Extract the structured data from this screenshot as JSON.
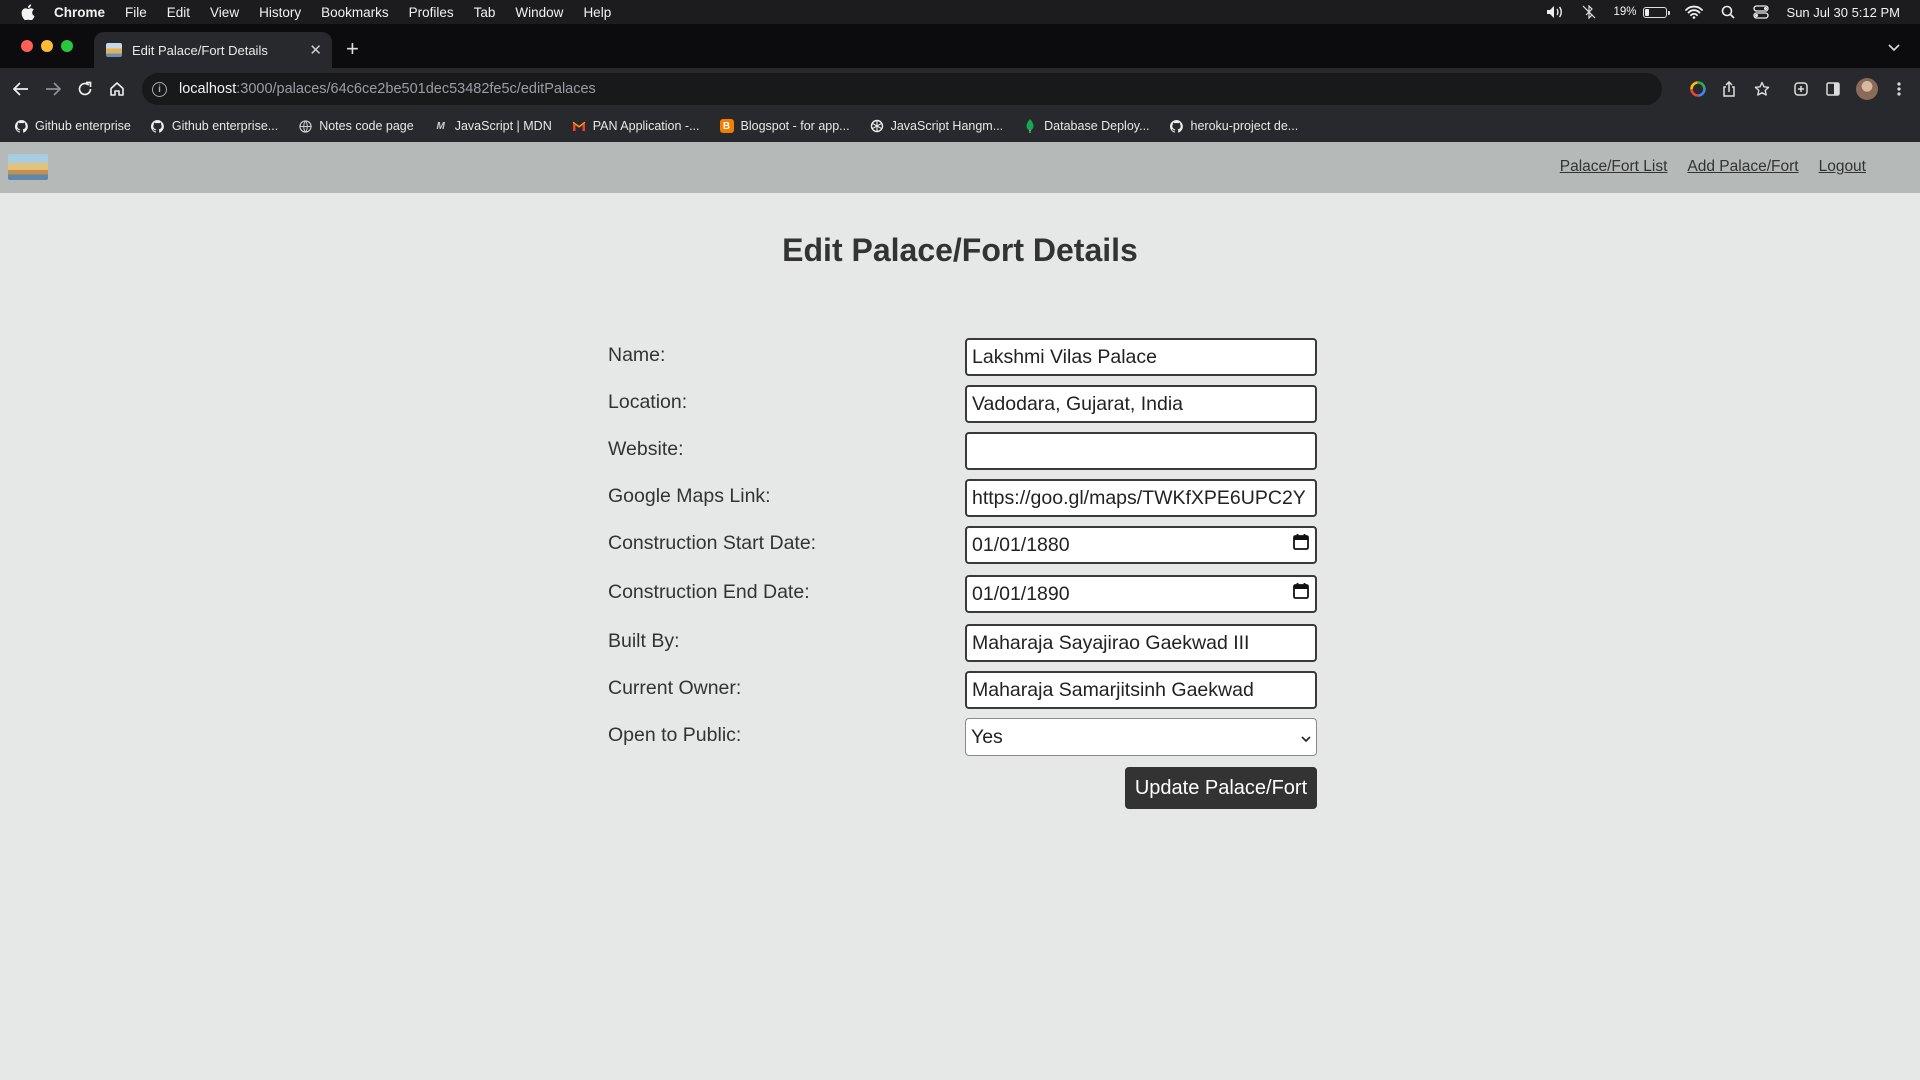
{
  "menubar": {
    "app_name": "Chrome",
    "items": [
      "File",
      "Edit",
      "View",
      "History",
      "Bookmarks",
      "Profiles",
      "Tab",
      "Window",
      "Help"
    ],
    "battery_percent": "19%",
    "datetime": "Sun Jul 30  5:12 PM"
  },
  "browser": {
    "tab_title": "Edit Palace/Fort Details",
    "url_host": "localhost",
    "url_path": ":3000/palaces/64c6ce2be501dec53482fe5c/editPalaces",
    "bookmarks": [
      {
        "label": "Github enterprise",
        "icon": "github-icon"
      },
      {
        "label": "Github enterprise...",
        "icon": "github-icon"
      },
      {
        "label": "Notes code page",
        "icon": "globe-icon"
      },
      {
        "label": "JavaScript | MDN",
        "icon": "mdn-icon"
      },
      {
        "label": "PAN Application -...",
        "icon": "gmail-icon"
      },
      {
        "label": "Blogspot - for app...",
        "icon": "blogger-icon"
      },
      {
        "label": "JavaScript Hangm...",
        "icon": "openai-icon"
      },
      {
        "label": "Database Deploy...",
        "icon": "mongodb-icon"
      },
      {
        "label": "heroku-project de...",
        "icon": "github-icon"
      }
    ]
  },
  "site_nav": {
    "links": [
      "Palace/Fort List",
      "Add Palace/Fort",
      "Logout"
    ]
  },
  "page": {
    "title": "Edit Palace/Fort Details"
  },
  "form": {
    "name": {
      "label": "Name:",
      "value": "Lakshmi Vilas Palace"
    },
    "location": {
      "label": "Location:",
      "value": "Vadodara, Gujarat, India"
    },
    "website": {
      "label": "Website:",
      "value": ""
    },
    "maps_link": {
      "label": "Google Maps Link:",
      "value": "https://goo.gl/maps/TWKfXPE6UPC2Y"
    },
    "start_date": {
      "label": "Construction Start Date:",
      "value": "01/01/1880"
    },
    "end_date": {
      "label": "Construction End Date:",
      "value": "01/01/1890"
    },
    "built_by": {
      "label": "Built By:",
      "value": "Maharaja Sayajirao Gaekwad III"
    },
    "current_owner": {
      "label": "Current Owner:",
      "value": "Maharaja Samarjitsinh Gaekwad"
    },
    "open_to_public": {
      "label": "Open to Public:",
      "value": "Yes"
    },
    "submit_label": "Update Palace/Fort"
  }
}
